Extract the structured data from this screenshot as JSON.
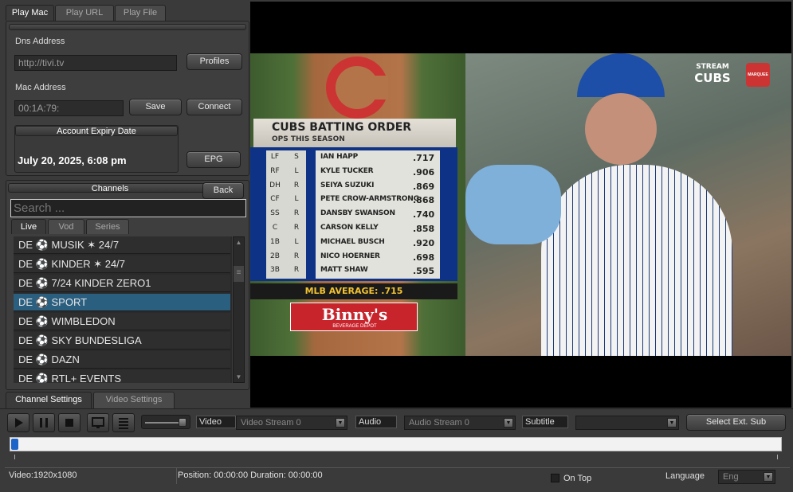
{
  "tabs": {
    "play_mac": "Play Mac",
    "play_url": "Play URL",
    "play_file": "Play File"
  },
  "form": {
    "dns_label": "Dns Address",
    "dns_value": "http://tivi.tv",
    "profiles_btn": "Profiles",
    "mac_label": "Mac Address",
    "mac_value": "00:1A:79:",
    "save_btn": "Save",
    "connect_btn": "Connect",
    "expiry_label": "Account Expiry Date",
    "expiry_value": "July 20, 2025, 6:08 pm",
    "epg_btn": "EPG"
  },
  "channels": {
    "title": "Channels",
    "back_btn": "Back",
    "search_placeholder": "Search ...",
    "subtabs": {
      "live": "Live",
      "vod": "Vod",
      "series": "Series"
    },
    "items": [
      {
        "prefix": "DE",
        "name": "MUSIK ✶ 24/7"
      },
      {
        "prefix": "DE",
        "name": "KINDER ✶ 24/7"
      },
      {
        "prefix": "DE",
        "name": "7/24 KINDER ZERO1"
      },
      {
        "prefix": "DE",
        "name": "SPORT"
      },
      {
        "prefix": "DE",
        "name": "WIMBLEDON"
      },
      {
        "prefix": "DE",
        "name": "SKY BUNDESLIGA"
      },
      {
        "prefix": "DE",
        "name": "DAZN"
      },
      {
        "prefix": "DE",
        "name": "RTL+ EVENTS"
      }
    ],
    "selected_index": 3
  },
  "settings_tabs": {
    "channel": "Channel Settings",
    "video": "Video Settings"
  },
  "video_overlay": {
    "heading": "CUBS BATTING ORDER",
    "subheading": "OPS THIS SEASON",
    "lineup": [
      {
        "pos": "LF",
        "bats": "S",
        "player": "IAN HAPP",
        "ops": ".717"
      },
      {
        "pos": "RF",
        "bats": "L",
        "player": "KYLE TUCKER",
        "ops": ".906"
      },
      {
        "pos": "DH",
        "bats": "R",
        "player": "SEIYA SUZUKI",
        "ops": ".869"
      },
      {
        "pos": "CF",
        "bats": "L",
        "player": "PETE CROW-ARMSTRONG",
        "ops": ".868"
      },
      {
        "pos": "SS",
        "bats": "R",
        "player": "DANSBY SWANSON",
        "ops": ".740"
      },
      {
        "pos": "C",
        "bats": "R",
        "player": "CARSON KELLY",
        "ops": ".858"
      },
      {
        "pos": "1B",
        "bats": "L",
        "player": "MICHAEL BUSCH",
        "ops": ".920"
      },
      {
        "pos": "2B",
        "bats": "R",
        "player": "NICO HOERNER",
        "ops": ".698"
      },
      {
        "pos": "3B",
        "bats": "R",
        "player": "MATT SHAW",
        "ops": ".595"
      }
    ],
    "mlb_average": "MLB AVERAGE: .715",
    "sponsor": "Binny's",
    "sponsor_sub": "BEVERAGE DEPOT",
    "bug_top": "STREAM",
    "bug_mid": "CUBS",
    "bug_brand": "MARQUEE"
  },
  "player_controls": {
    "video_label": "Video",
    "video_stream": "Video Stream 0",
    "audio_label": "Audio",
    "audio_stream": "Audio Stream 0",
    "subtitle_label": "Subtitle",
    "subtitle_value": "",
    "select_ext_sub": "Select Ext. Sub"
  },
  "status_bar": {
    "video_info": "Video:1920x1080",
    "position": "Position: 00:00:00 Duration: 00:00:00",
    "on_top": "On Top",
    "language_label": "Language",
    "language_value": "Eng"
  },
  "colors": {
    "selected_row": "#2b5f80",
    "cubs_blue": "#0e3386",
    "cubs_red": "#cc3433"
  }
}
